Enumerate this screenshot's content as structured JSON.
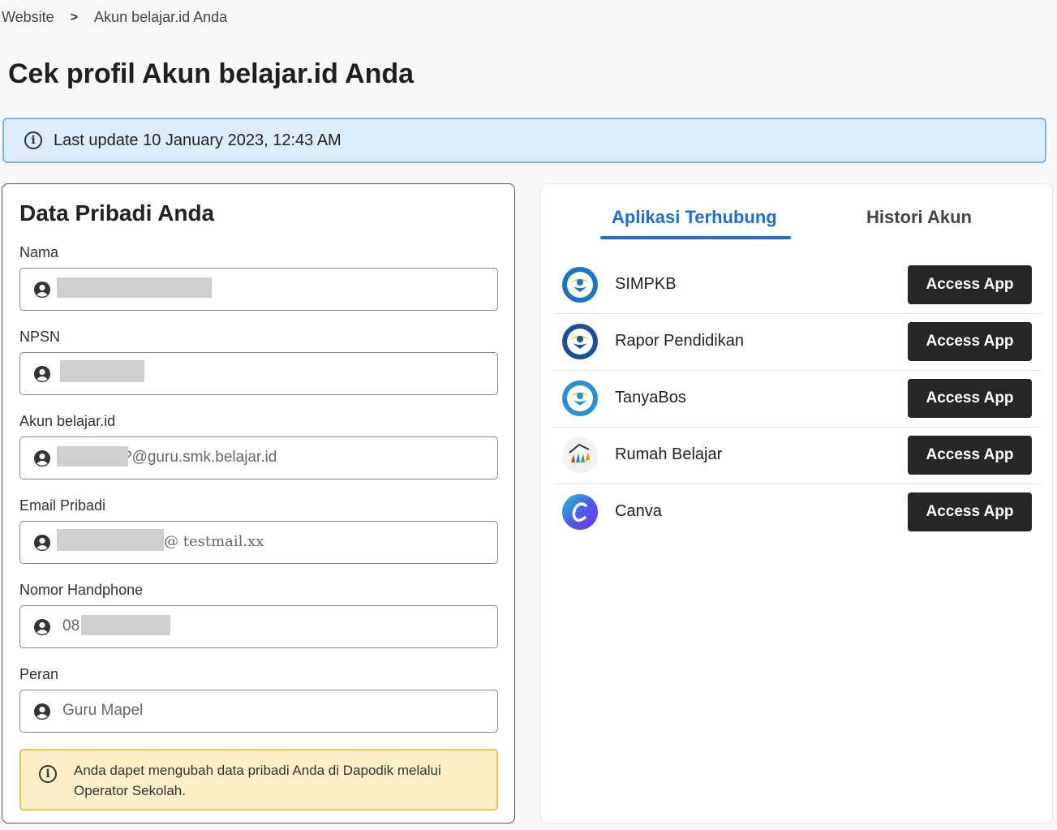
{
  "breadcrumb": {
    "root": "Website",
    "separator": ">",
    "current": "Akun belajar.id Anda"
  },
  "page_title": "Cek profil Akun belajar.id Anda",
  "banner": {
    "text": "Last update 10 January 2023, 12:43 AM",
    "icon": "info-icon"
  },
  "personal": {
    "title": "Data Pribadi Anda",
    "fields": [
      {
        "label": "Nama",
        "value": ""
      },
      {
        "label": "NPSN",
        "value": ""
      },
      {
        "label": "Akun belajar.id",
        "value": "?@guru.smk.belajar.id"
      },
      {
        "label": "Email Pribadi",
        "value": "@ testmail.xx"
      },
      {
        "label": "Nomor Handphone",
        "value": "08"
      },
      {
        "label": "Peran",
        "value": "Guru Mapel"
      }
    ],
    "note": "Anda dapet mengubah data pribadi Anda di Dapodik melalui Operator Sekolah."
  },
  "tabs": {
    "active": "Aplikasi Terhubung",
    "inactive": "Histori Akun"
  },
  "apps": [
    {
      "name": "SIMPKB",
      "icon": "tut-wuri-logo-icon",
      "button": "Access App"
    },
    {
      "name": "Rapor Pendidikan",
      "icon": "tut-wuri-logo-icon",
      "button": "Access App"
    },
    {
      "name": "TanyaBos",
      "icon": "tut-wuri-logo-icon",
      "button": "Access App"
    },
    {
      "name": "Rumah Belajar",
      "icon": "rumah-belajar-logo-icon",
      "button": "Access App"
    },
    {
      "name": "Canva",
      "icon": "canva-logo-icon",
      "button": "Access App"
    }
  ],
  "colors": {
    "accent": "#1f6fd6",
    "button": "#262626",
    "banner_bg": "#dcecfb",
    "note_bg": "#fdf0c8"
  }
}
